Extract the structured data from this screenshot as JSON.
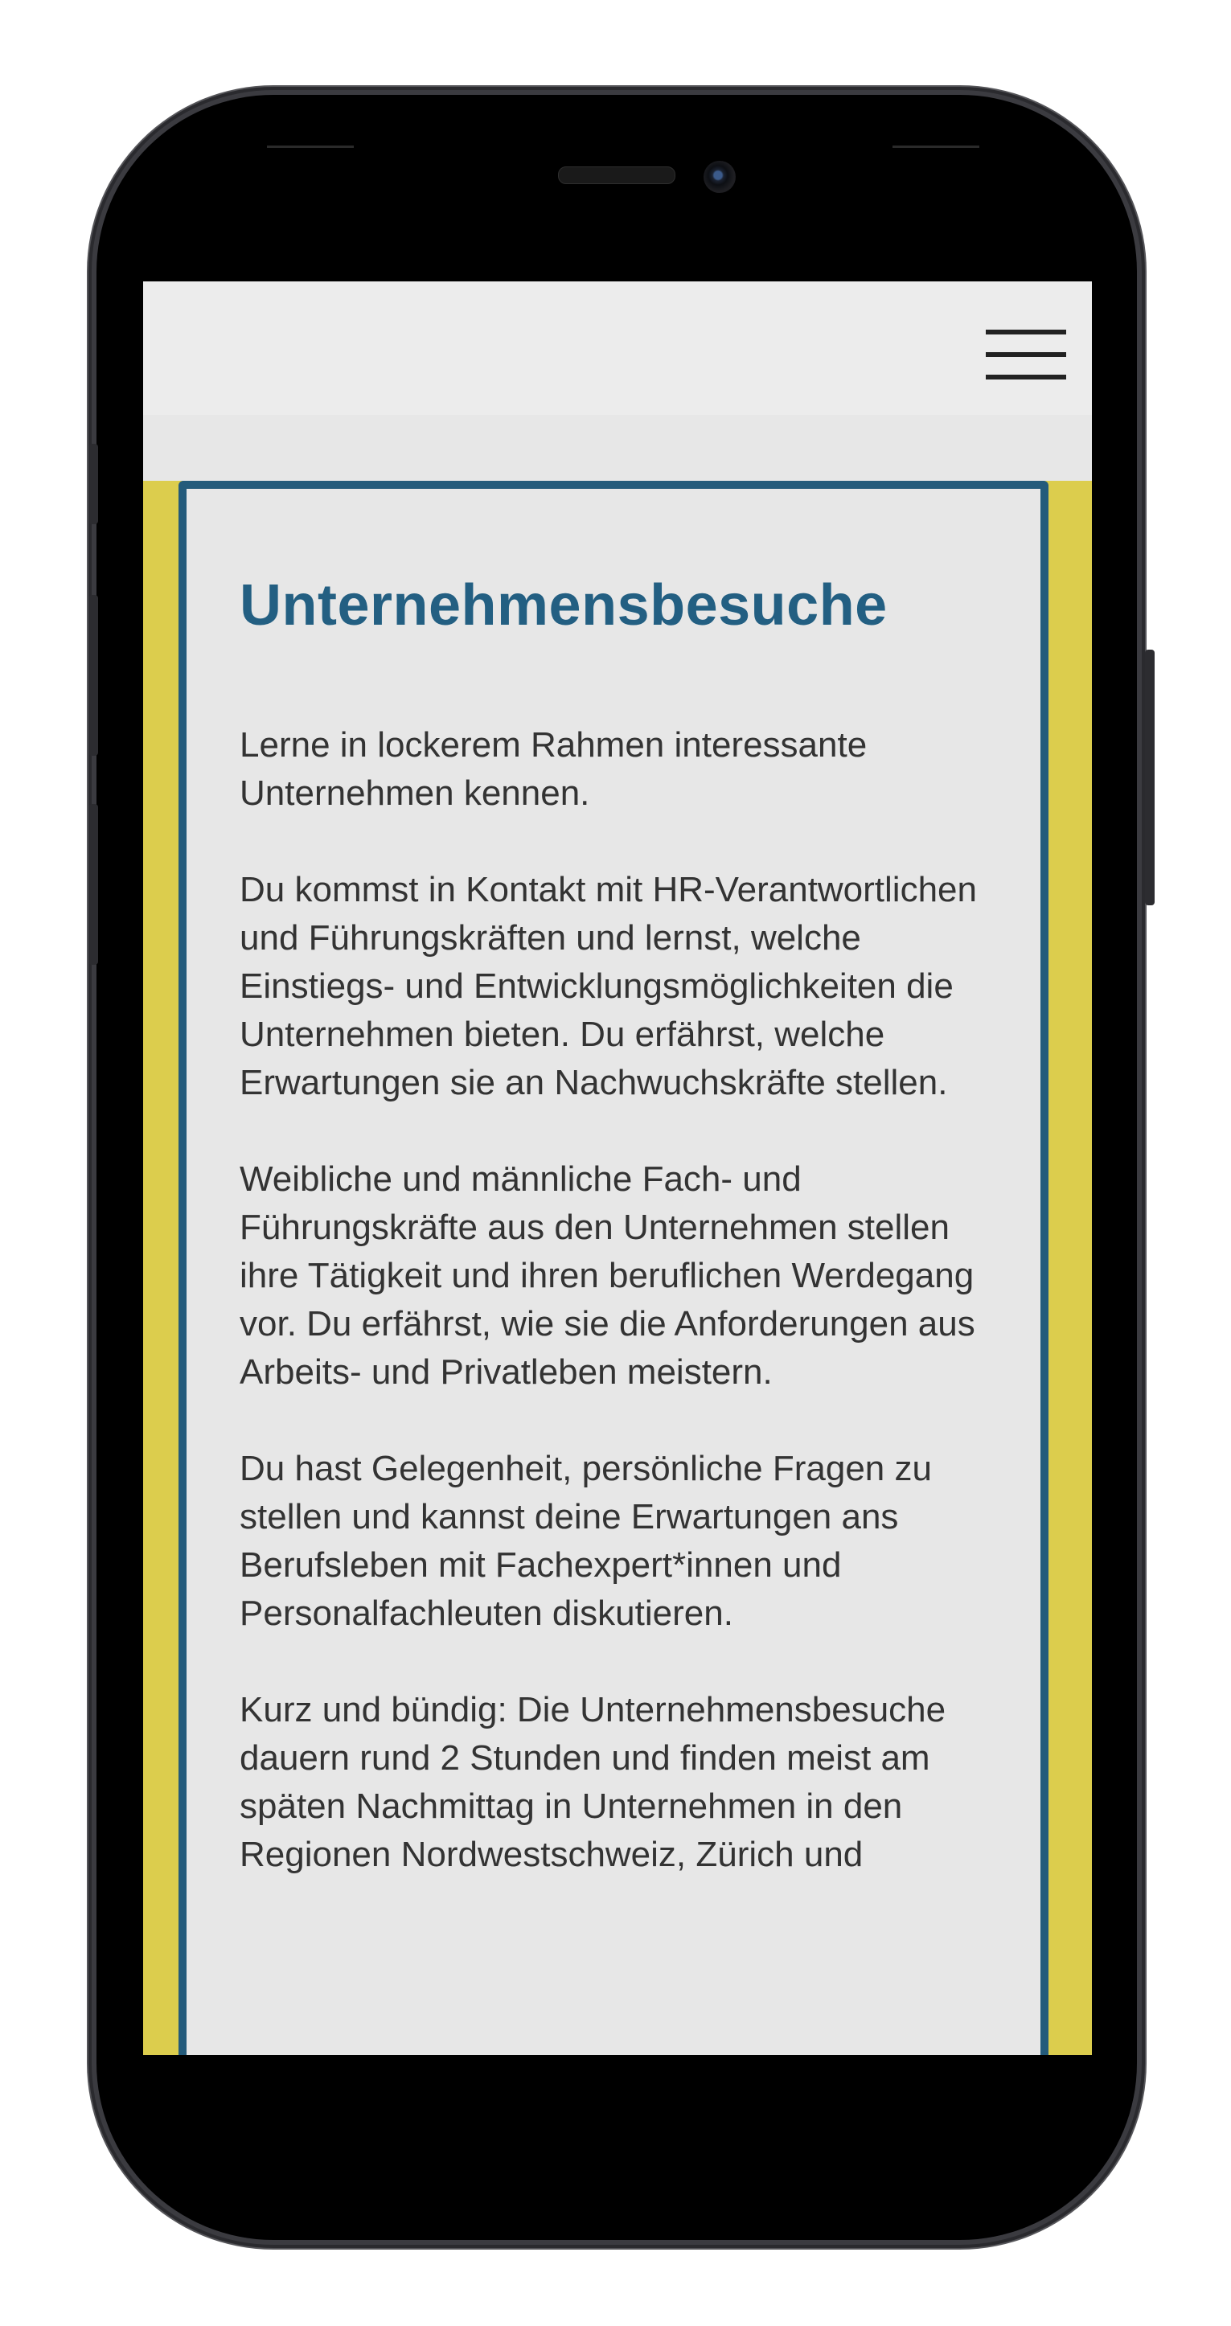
{
  "header": {
    "menu_icon": "hamburger-menu-icon"
  },
  "content": {
    "title": "Unternehmensbesuche",
    "paragraphs": [
      "Lerne in lockerem Rahmen interessante Unternehmen kennen.",
      "Du kommst in Kontakt mit HR-Verantwortlichen und Führungskräften und lernst, welche Einstiegs- und Entwicklungsmöglichkeiten die Unternehmen bieten. Du erfährst, welche Erwartungen sie an Nachwuchskräfte stellen.",
      "Weibliche und männliche Fach- und Führungskräfte aus den Unternehmen stellen ihre Tätigkeit und ihren beruflichen Werdegang vor. Du erfährst, wie sie die Anforderungen aus Arbeits- und Privatleben meistern.",
      "Du hast Gelegenheit, persönliche Fragen zu stellen und kannst deine Erwartungen ans Berufsleben mit Fachexpert*innen und Personalfachleuten diskutieren.",
      "Kurz und bündig: Die Unternehmensbesuche dauern rund 2 Stunden und finden meist am späten Nachmittag in Unternehmen in den Regionen Nordwestschweiz, Zürich und"
    ]
  },
  "colors": {
    "page_background": "#dccd4d",
    "card_border": "#245b7b",
    "title": "#235f82",
    "text": "#333333"
  }
}
